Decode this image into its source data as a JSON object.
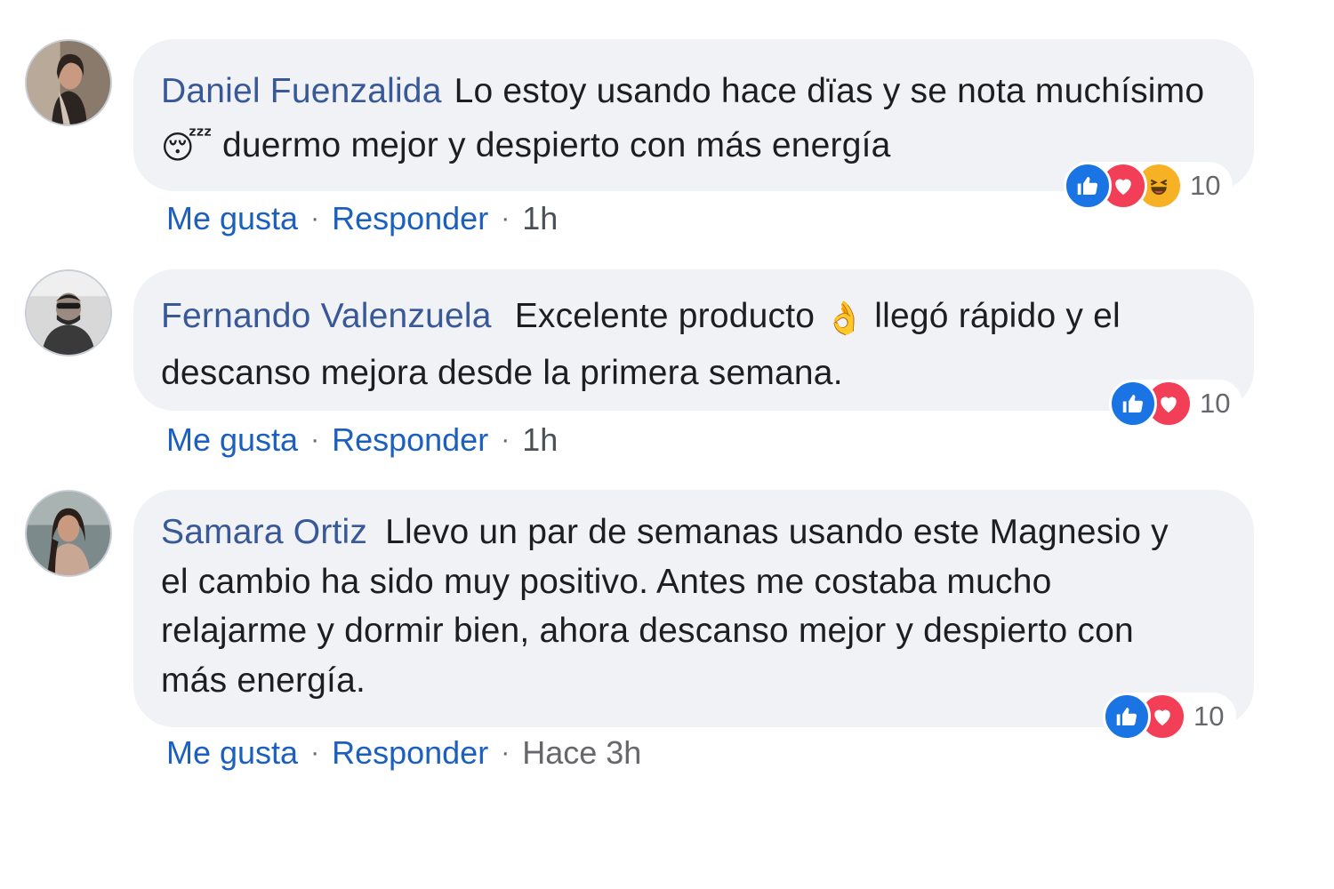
{
  "comments": [
    {
      "author": "Daniel Fuenzalida",
      "text_before_emoji": "Lo estoy usando hace dïas y se nota muchísimo ",
      "emoji": "😴",
      "text_after_emoji": " duermo mejor y despierto con más energía",
      "reactions": [
        "like-icon",
        "love-icon",
        "haha-icon"
      ],
      "reaction_count": "10",
      "like_label": "Me gusta",
      "reply_label": "Responder",
      "separator": "·",
      "time": "1h"
    },
    {
      "author": "Fernando Valenzuela",
      "text_before_emoji": "Excelente producto ",
      "emoji": "👌",
      "text_after_emoji": " llegó rápido y el descanso mejora desde la primera semana.",
      "reactions": [
        "like-icon",
        "love-icon"
      ],
      "reaction_count": "10",
      "like_label": "Me gusta",
      "reply_label": "Responder",
      "separator": "·",
      "time": "1h"
    },
    {
      "author": "Samara Ortiz",
      "text": "Llevo un par de semanas usando este Magnesio y el cambio ha sido muy positivo. Antes me costaba mucho relajarme y dormir bien, ahora descanso mejor y despierto con más energía.",
      "reactions": [
        "like-icon",
        "love-icon"
      ],
      "reaction_count": "10",
      "like_label": "Me gusta",
      "reply_label": "Responder",
      "separator": "·",
      "time": "Hace 3h"
    }
  ],
  "colors": {
    "author": "#385898",
    "link": "#1b5fbf",
    "bubble": "#f0f2f5",
    "like": "#1b74e4",
    "love": "#f33e58",
    "haha": "#f7b125"
  }
}
